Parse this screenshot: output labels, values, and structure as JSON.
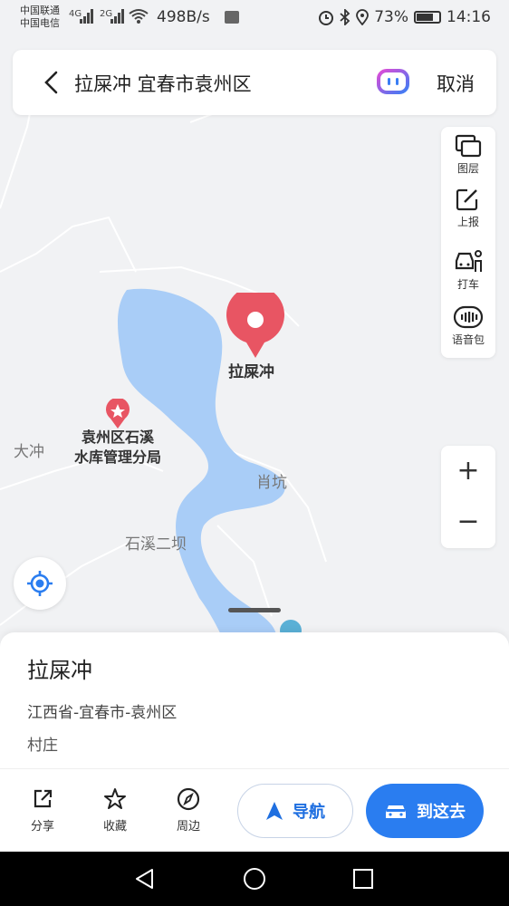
{
  "status": {
    "carrier1": "中国联通",
    "carrier2": "中国电信",
    "net1": "4G",
    "net2": "2G",
    "speed": "498B/s",
    "battery": "73%",
    "time": "14:16"
  },
  "search": {
    "query": "拉屎冲 宜春市袁州区",
    "cancel_label": "取消"
  },
  "tools": [
    {
      "label": "图层",
      "icon": "layers-icon"
    },
    {
      "label": "上报",
      "icon": "report-icon"
    },
    {
      "label": "打车",
      "icon": "taxi-icon"
    },
    {
      "label": "语音包",
      "icon": "voice-pack-icon"
    }
  ],
  "zoom": {
    "in": "+",
    "out": "−"
  },
  "map": {
    "labels": {
      "dachong": "大冲",
      "xiaokeng": "肖坑",
      "shixi_dam": "石溪二坝"
    },
    "marker_label": "拉屎冲",
    "poi_label_line1": "袁州区石溪",
    "poi_label_line2": "水库管理分局",
    "water_color": "#a9cdf7",
    "marker_color": "#e85563"
  },
  "place": {
    "name": "拉屎冲",
    "region": "江西省-宜春市-袁州区",
    "type": "村庄"
  },
  "actions": {
    "share": "分享",
    "favorite": "收藏",
    "nearby": "周边",
    "navigate": "导航",
    "go_here": "到这去"
  },
  "colors": {
    "accent": "#2a7df0"
  }
}
